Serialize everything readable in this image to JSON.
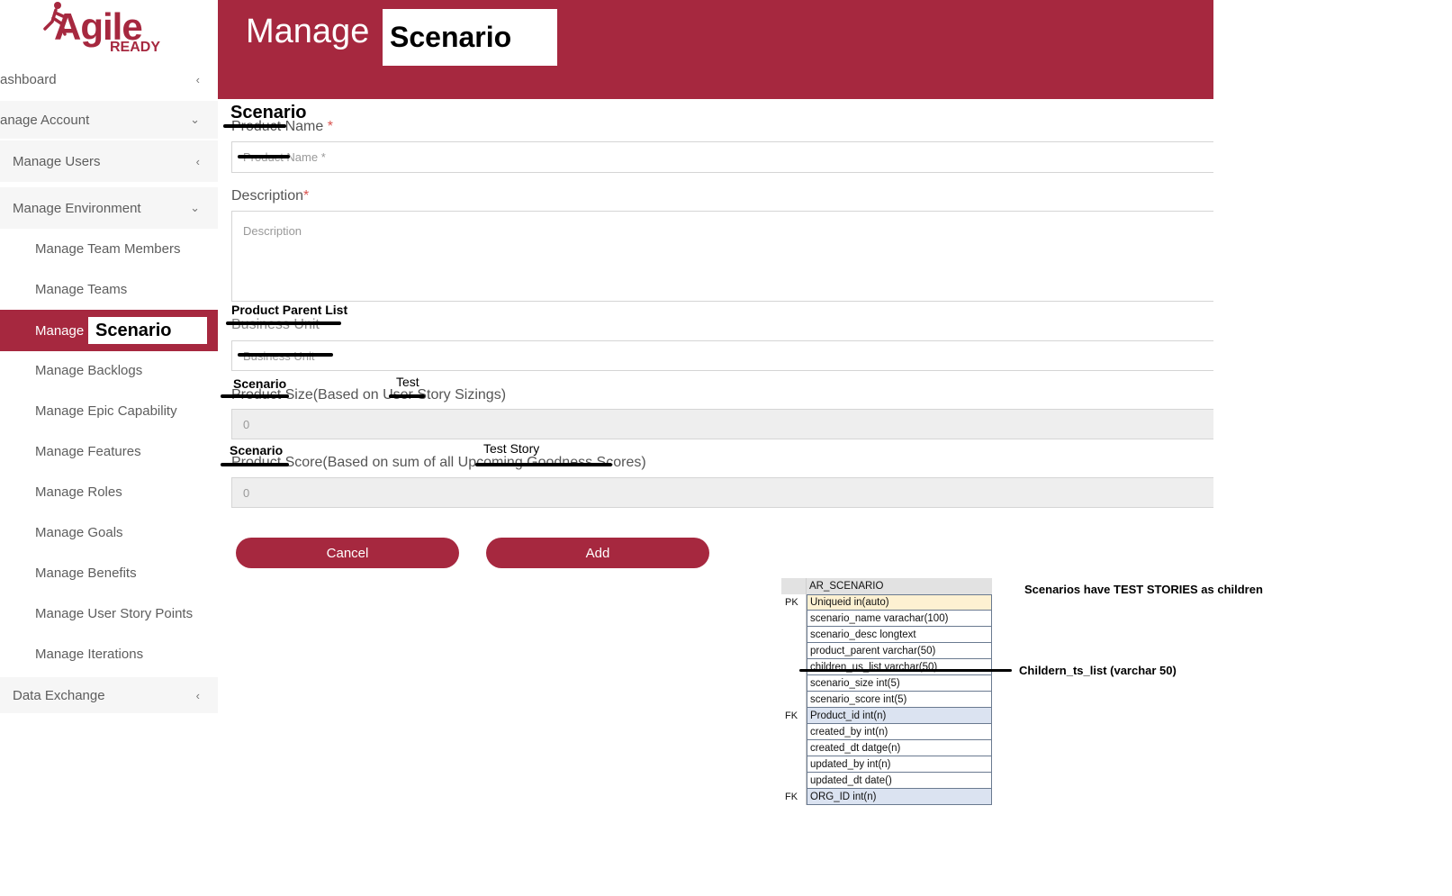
{
  "logo": {
    "word": "Agile",
    "sub": "READY"
  },
  "sidebar": {
    "items": [
      {
        "label": "ashboard",
        "chevron": "‹"
      },
      {
        "label": "anage Account",
        "chevron": "⌄"
      },
      {
        "label": "Manage Users",
        "chevron": "‹"
      },
      {
        "label": "Manage Environment",
        "chevron": "⌄"
      },
      {
        "label": "Manage Team Members"
      },
      {
        "label": "Manage Teams"
      },
      {
        "label": "Manage",
        "overlay": "Scenario"
      },
      {
        "label": "Manage Backlogs"
      },
      {
        "label": "Manage Epic Capability"
      },
      {
        "label": "Manage Features"
      },
      {
        "label": "Manage Roles"
      },
      {
        "label": "Manage Goals"
      },
      {
        "label": "Manage Benefits"
      },
      {
        "label": "Manage User Story Points"
      },
      {
        "label": "Manage Iterations"
      },
      {
        "label": "Data Exchange",
        "chevron": "‹"
      }
    ]
  },
  "header": {
    "title": "Manage",
    "title_overlay": "Scenario"
  },
  "form": {
    "name": {
      "overlay": "Scenario",
      "label": "Product Name",
      "required": "*",
      "placeholder": "Product Name *"
    },
    "description": {
      "label": "Description",
      "required": "*",
      "placeholder": "Description"
    },
    "parent": {
      "overlay": "Product Parent List",
      "label": "Business Unit",
      "placeholder": "Business Unit"
    },
    "size": {
      "overlay1": "Scenario",
      "overlay2": "Test",
      "label": "Product Size(Based on User Story Sizings)",
      "value": "0"
    },
    "score": {
      "overlay1": "Scenario",
      "overlay2": "Test Story",
      "label": "Product Score(Based on sum of all Upcoming Goodness Scores)",
      "value": "0"
    },
    "cancel_label": "Cancel",
    "add_label": "Add"
  },
  "er_table": {
    "name": "AR_SCENARIO",
    "rows": [
      {
        "key": "PK",
        "field": "Uniqueid in(auto)"
      },
      {
        "key": "",
        "field": "scenario_name varachar(100)"
      },
      {
        "key": "",
        "field": "scenario_desc longtext"
      },
      {
        "key": "",
        "field": "product_parent varchar(50)"
      },
      {
        "key": "",
        "field": "children_us_list varchar(50)"
      },
      {
        "key": "",
        "field": "scenario_size int(5)"
      },
      {
        "key": "",
        "field": "scenario_score int(5)"
      },
      {
        "key": "FK",
        "field": "Product_id int(n)"
      },
      {
        "key": "",
        "field": "created_by int(n)"
      },
      {
        "key": "",
        "field": "created_dt datge(n)"
      },
      {
        "key": "",
        "field": "updated_by int(n)"
      },
      {
        "key": "",
        "field": "updated_dt date()"
      },
      {
        "key": "FK",
        "field": "ORG_ID int(n)"
      }
    ]
  },
  "notes": {
    "children": "Scenarios have TEST STORIES as children",
    "list": "Childern_ts_list (varchar 50)"
  },
  "colors": {
    "brand": "#a6283f",
    "pk_fill": "#fdf1d2",
    "fk_fill": "#dbe3f1"
  }
}
